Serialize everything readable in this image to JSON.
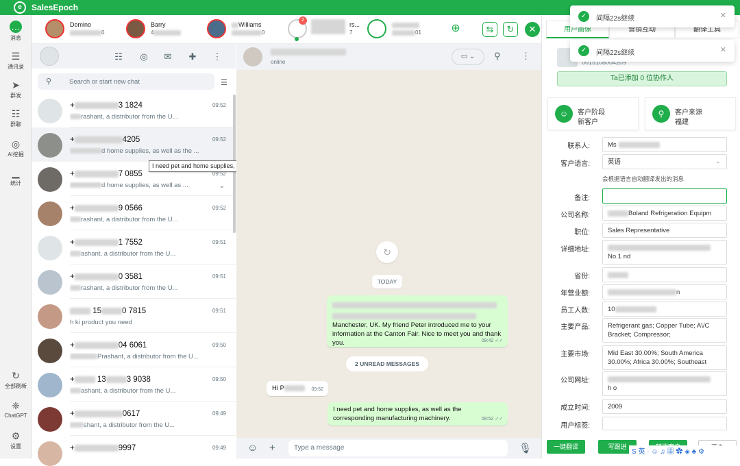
{
  "app": {
    "brand": "SalesEpoch",
    "logo_letter": "e"
  },
  "left_nav": [
    {
      "label": "消息",
      "icon": "chat-bubble-icon",
      "glyph": "…"
    },
    {
      "label": "通讯录",
      "icon": "contacts-icon",
      "glyph": "☰"
    },
    {
      "label": "群发",
      "icon": "send-icon",
      "glyph": "➤"
    },
    {
      "label": "群聊",
      "icon": "group-chat-icon",
      "glyph": "☷"
    },
    {
      "label": "AI挖掘",
      "icon": "ai-icon",
      "glyph": "◎"
    },
    {
      "label": "统计",
      "icon": "stats-icon",
      "glyph": "▁"
    },
    {
      "label": "全部刷新",
      "icon": "refresh-icon",
      "glyph": "↻"
    },
    {
      "label": "ChatGPT",
      "icon": "chatgpt-icon",
      "glyph": "❈"
    },
    {
      "label": "设置",
      "icon": "gear-icon",
      "glyph": "⚙"
    }
  ],
  "accounts": [
    {
      "name": "Domino",
      "sub": "0"
    },
    {
      "name": "Barry",
      "sub": "4"
    },
    {
      "name": "Williams",
      "sub": "0"
    },
    {
      "name": "",
      "sub": "",
      "badge": "2"
    },
    {
      "name": "rs...",
      "sub": "7"
    },
    {
      "name": "",
      "sub": "01"
    }
  ],
  "chat_list": {
    "search_placeholder": "Search or start new chat",
    "rows": [
      {
        "number": "3 1824",
        "time": "09:52",
        "preview": "rashant, a distributor from the U..."
      },
      {
        "number": "4205",
        "time": "09:52",
        "preview": "d home supplies, as well as the ..."
      },
      {
        "number": "7 0855",
        "time": "09:52",
        "preview": "d home supplies, as well as ..."
      },
      {
        "number": "9 0566",
        "time": "09:52",
        "preview": "rashant, a distributor from the U..."
      },
      {
        "number": "1 7552",
        "time": "09:51",
        "preview": "ashant, a distributor from the U..."
      },
      {
        "number": "0 3581",
        "time": "09:51",
        "preview": "rashant, a distributor from the U..."
      },
      {
        "number": "0 7815",
        "time": "09:51",
        "preview": "h ki   product you need"
      },
      {
        "number": "04 6061",
        "time": "09:50",
        "preview": "Prashant, a distributor from the U..."
      },
      {
        "number": "3 9038",
        "time": "09:50",
        "preview": "ashant, a distributor from the U..."
      },
      {
        "number": "0617",
        "time": "09:49",
        "preview": "shant, a distributor from the U..."
      },
      {
        "number": "9997",
        "time": "09:49",
        "preview": ""
      }
    ],
    "tooltip": "I need pet and home supplies, as well as the corresponding manufacturing machinery."
  },
  "chat": {
    "status": "online",
    "date_chip": "TODAY",
    "msg1": "Manchester, UK. My friend Peter introduced me to your information at the Canton Fair. Nice to meet you and thank you.",
    "msg1_time": "09:42",
    "unread": "2 UNREAD MESSAGES",
    "msg2": "Hi P",
    "msg2_time": "09:52",
    "msg3": "I need pet and home supplies, as well as the corresponding manufacturing machinery.",
    "msg3_time": "09:52",
    "composer_placeholder": "Type a message"
  },
  "right_panel": {
    "tabs": [
      "用户画像",
      "营销互动",
      "翻译工具"
    ],
    "toasts": [
      "间隔22s继续",
      "间隔22s继续"
    ],
    "phone": "0015108004209",
    "collab": "Ta已添加 0 位协作人",
    "stage_label": "客户阶段",
    "stage_value": "新客户",
    "source_label": "客户来源",
    "source_value": "福建",
    "fields": [
      {
        "label": "联系人:",
        "value": "Ms"
      },
      {
        "label": "客户语言:",
        "value": "英语"
      },
      {
        "label": "备注:",
        "value": ""
      },
      {
        "label": "公司名称:",
        "value": "Boland Refrigeration Equipm"
      },
      {
        "label": "职位:",
        "value": "Sales Representative"
      },
      {
        "label": "详细地址:",
        "value": "No.1   nd"
      },
      {
        "label": "省份:",
        "value": ""
      },
      {
        "label": "年营业额:",
        "value": "n"
      },
      {
        "label": "员工人数:",
        "value": "10"
      },
      {
        "label": "主要产品:",
        "value": "Refrigerant gas; Copper Tube; A\\/C Bracket; Compressor;"
      },
      {
        "label": "主要市场:",
        "value": "Mid East 30.00%; South America 30.00%; Africa 30.00%; Southeast"
      },
      {
        "label": "公司网址:",
        "value": "h   o"
      },
      {
        "label": "成立时间:",
        "value": "2009"
      },
      {
        "label": "用户标签:",
        "value": ""
      }
    ],
    "lang_hint": "会根据语言自动翻译发出的消息",
    "buttons": [
      "一键翻译",
      "写跟进",
      "转消客户",
      "更多"
    ]
  },
  "ime_bar": "S 英 · ☺ ♫ ▦ ✿ ◈ ♣ ⚙"
}
